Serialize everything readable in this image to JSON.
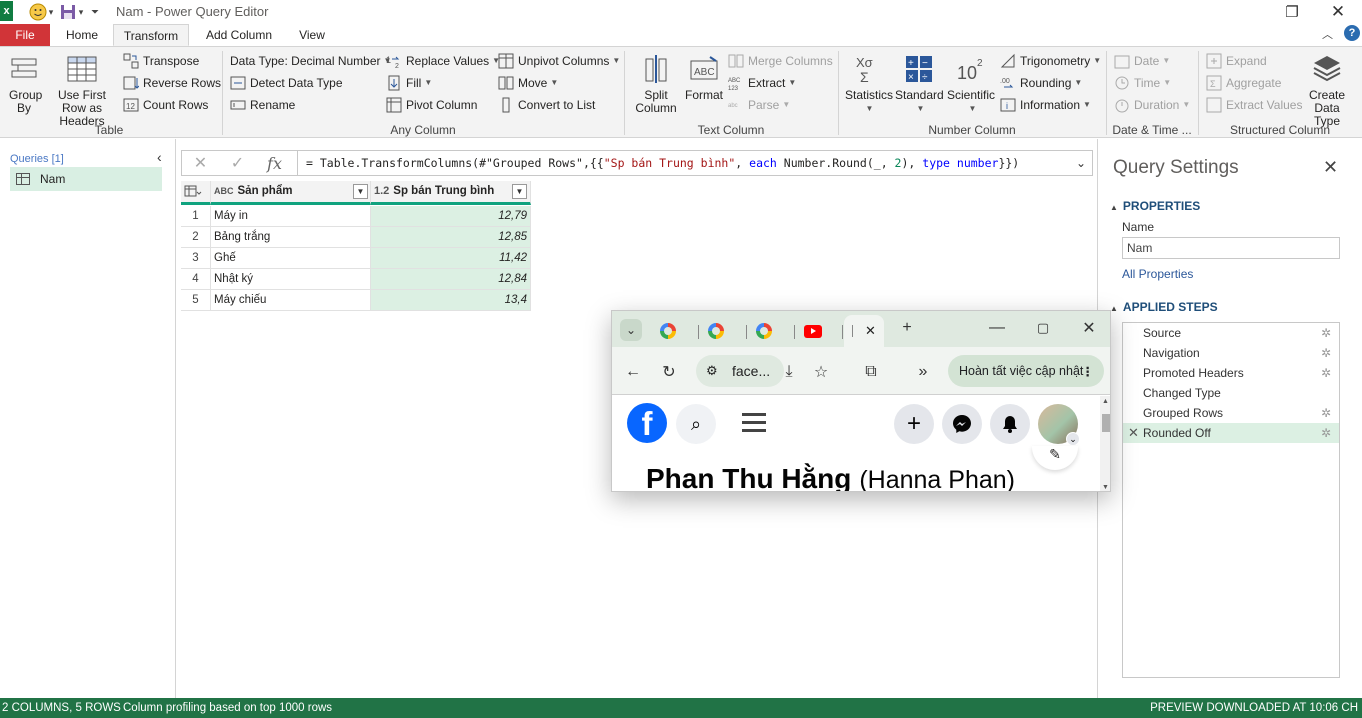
{
  "window": {
    "title": "Nam - Power Query Editor",
    "restore_icon": "restore-icon",
    "close_icon": "close-icon"
  },
  "tabs": [
    "File",
    "Home",
    "Transform",
    "Add Column",
    "View"
  ],
  "active_tab": "Transform",
  "ribbon": {
    "table_group": {
      "label": "Table",
      "group_by": "Group By",
      "use_first_row": "Use First Row as Headers",
      "transpose": "Transpose",
      "reverse_rows": "Reverse Rows",
      "count_rows": "Count Rows"
    },
    "any_column_group": {
      "label": "Any Column",
      "data_type": "Data Type: Decimal Number",
      "detect_data_type": "Detect Data Type",
      "rename": "Rename",
      "replace_values": "Replace Values",
      "fill": "Fill",
      "pivot_column": "Pivot Column",
      "unpivot_columns": "Unpivot Columns",
      "move": "Move",
      "convert_to_list": "Convert to List"
    },
    "text_column_group": {
      "label": "Text Column",
      "split_column": "Split Column",
      "format": "Format",
      "merge_columns": "Merge Columns",
      "extract": "Extract",
      "parse": "Parse"
    },
    "number_column_group": {
      "label": "Number Column",
      "statistics": "Statistics",
      "standard": "Standard",
      "scientific": "Scientific",
      "trigonometry": "Trigonometry",
      "rounding": "Rounding",
      "information": "Information"
    },
    "datetime_group": {
      "label": "Date & Time ...",
      "date": "Date",
      "time": "Time",
      "duration": "Duration"
    },
    "structured_group": {
      "label": "Structured Column",
      "expand": "Expand",
      "aggregate": "Aggregate",
      "extract_values": "Extract Values",
      "create_data_type": "Create Data Type"
    }
  },
  "queries": {
    "header": "Queries [1]",
    "items": [
      "Nam"
    ]
  },
  "formula": {
    "prefix": "= Table.TransformColumns(#\"Grouped Rows\",{{",
    "str1": "\"Sp bán Trung bình\"",
    "mid1": ", ",
    "kw1": "each",
    "mid2": " Number.Round(_, ",
    "num1": "2",
    "mid3": "), ",
    "kw2": "type",
    "mid4": " ",
    "kw3": "number",
    "suffix": "}})"
  },
  "grid": {
    "col1_type": "ABC",
    "col1": "Sản phẩm",
    "col2_type": "1.2",
    "col2": "Sp bán Trung bình",
    "rows": [
      {
        "n": "1",
        "product": "Máy in",
        "avg": "12,79"
      },
      {
        "n": "2",
        "product": "Bảng trắng",
        "avg": "12,85"
      },
      {
        "n": "3",
        "product": "Ghế",
        "avg": "11,42"
      },
      {
        "n": "4",
        "product": "Nhật ký",
        "avg": "12,84"
      },
      {
        "n": "5",
        "product": "Máy chiếu",
        "avg": "13,4"
      }
    ]
  },
  "settings": {
    "title": "Query Settings",
    "properties": "PROPERTIES",
    "name_label": "Name",
    "name_value": "Nam",
    "all_properties": "All Properties",
    "applied_steps": "APPLIED STEPS",
    "steps": [
      "Source",
      "Navigation",
      "Promoted Headers",
      "Changed Type",
      "Grouped Rows",
      "Rounded Off"
    ],
    "selected_step": "Rounded Off"
  },
  "status": {
    "left": "2 COLUMNS, 5 ROWS",
    "profiling": "Column profiling based on top 1000 rows",
    "right": "PREVIEW DOWNLOADED AT 10:06 CH"
  },
  "browser": {
    "address": "face...",
    "update_button": "Hoàn tất việc cập nhật",
    "profile_name": "Phan Thu Hằng",
    "profile_alt": "(Hanna Phan)"
  },
  "colors": {
    "accent_green": "#217346",
    "selection": "#dcf0e3",
    "file_tab": "#d13438",
    "facebook_blue": "#0866ff"
  }
}
